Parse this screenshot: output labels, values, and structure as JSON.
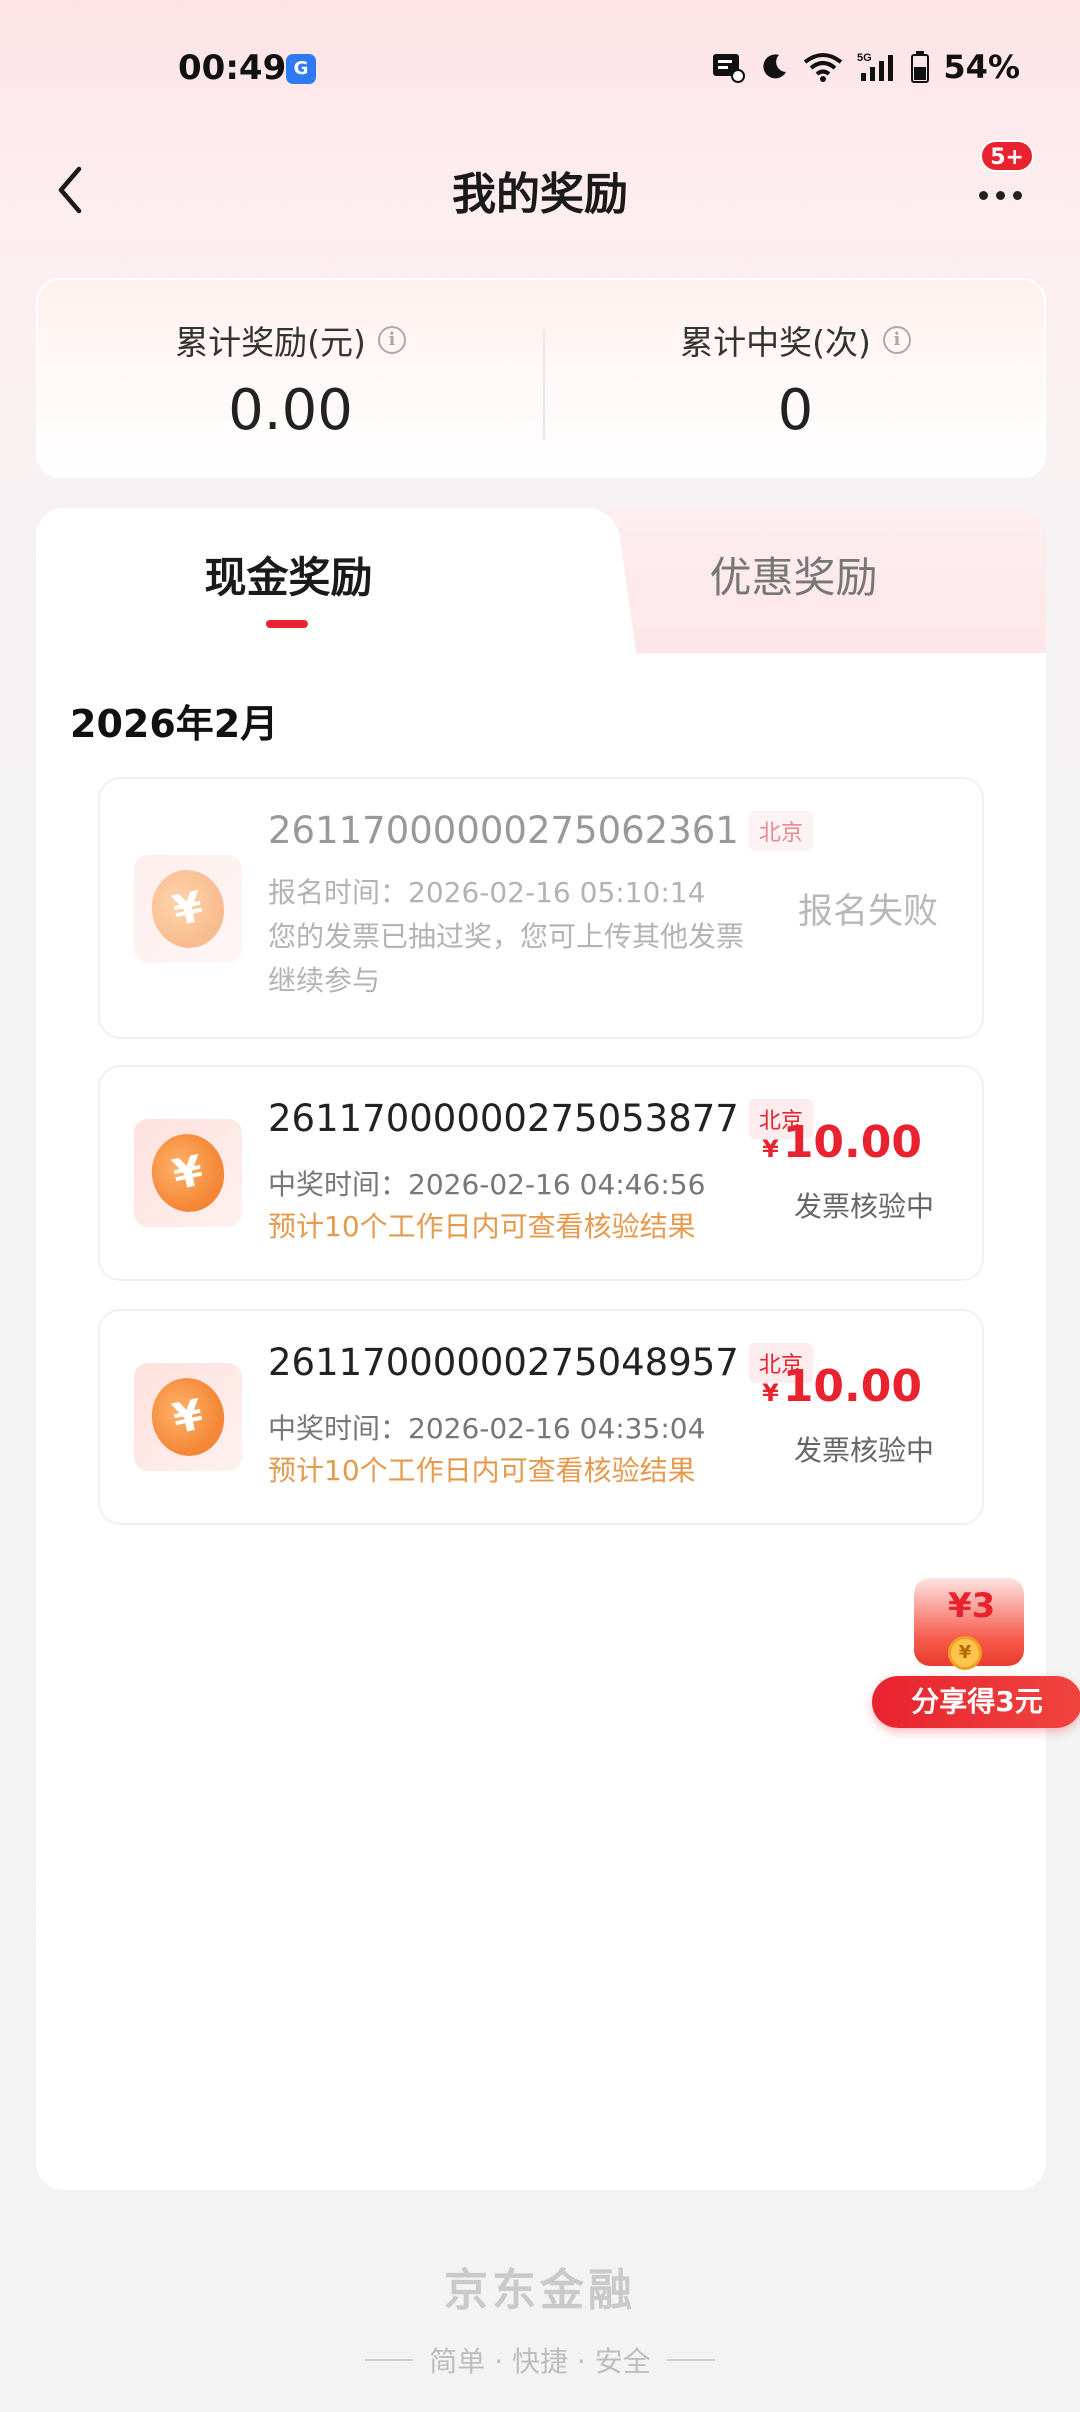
{
  "status_bar": {
    "time": "00:49",
    "battery": "54%",
    "network": "5G"
  },
  "nav": {
    "title": "我的奖励",
    "badge": "5+"
  },
  "summary": {
    "total_reward_label": "累计奖励(元)",
    "total_reward_value": "0.00",
    "total_wins_label": "累计中奖(次)",
    "total_wins_value": "0"
  },
  "tabs": {
    "cash": "现金奖励",
    "coupon": "优惠奖励"
  },
  "month": "2026年2月",
  "records": [
    {
      "id": "261170000002750623​61",
      "city": "北京",
      "time": "报名时间：2026-02-16 05:10:14",
      "note": "您的发票已抽过奖，您可上传其他发票继续参与",
      "status": "报名失败"
    },
    {
      "id": "261170000002750538​77",
      "city": "北京",
      "time": "中奖时间：2026-02-16 04:46:56",
      "note": "预计10个工作日内可查看核验结果",
      "currency": "¥",
      "amount": "10.00",
      "status": "发票核验中"
    },
    {
      "id": "261170000002750489​57",
      "city": "北京",
      "time": "中奖时间：2026-02-16 04:35:04",
      "note": "预计10个工作日内可查看核验结果",
      "currency": "¥",
      "amount": "10.00",
      "status": "发票核验中"
    }
  ],
  "float_share": {
    "amount": "¥3",
    "label": "分享得3元"
  },
  "footer": {
    "logo": "京东金融",
    "slogan": "简单 · 快捷 · 安全"
  },
  "colors": {
    "accent": "#e8232f",
    "note_orange": "#e69a4e"
  }
}
